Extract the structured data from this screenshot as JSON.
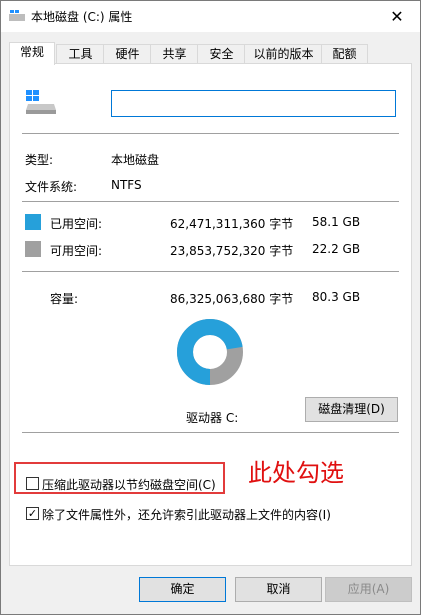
{
  "window": {
    "title": "本地磁盘 (C:) 属性",
    "close_glyph": "✕"
  },
  "tabs": [
    "常规",
    "工具",
    "硬件",
    "共享",
    "安全",
    "以前的版本",
    "配额"
  ],
  "general": {
    "name_value": "",
    "type_label": "类型:",
    "type_value": "本地磁盘",
    "fs_label": "文件系统:",
    "fs_value": "NTFS",
    "used_label": "已用空间:",
    "used_bytes": "62,471,311,360 字节",
    "used_gb": "58.1 GB",
    "free_label": "可用空间:",
    "free_bytes": "23,853,752,320 字节",
    "free_gb": "22.2 GB",
    "capacity_label": "容量:",
    "capacity_bytes": "86,325,063,680 字节",
    "capacity_gb": "80.3 GB",
    "drive_label": "驱动器 C:",
    "cleanup_button": "磁盘清理(D)",
    "compress_label": "压缩此驱动器以节约磁盘空间(C)",
    "index_label": "除了文件属性外，还允许索引此驱动器上文件的内容(I)",
    "used_fraction": 0.7237
  },
  "colors": {
    "used": "#26a0da",
    "free": "#a0a0a0",
    "annotation": "#e01010"
  },
  "annotation": "此处勾选",
  "footer": {
    "ok": "确定",
    "cancel": "取消",
    "apply": "应用(A)"
  }
}
